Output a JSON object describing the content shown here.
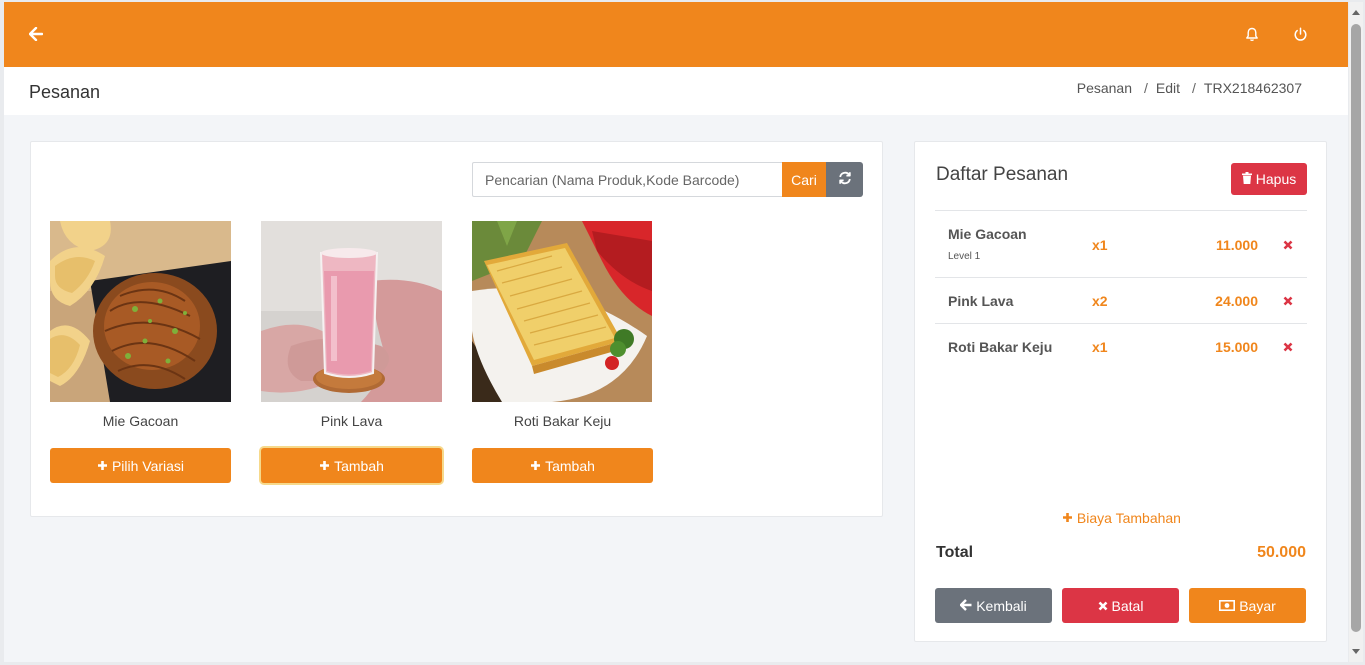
{
  "topbar": {
    "back_icon": "arrow-left-icon",
    "bell_icon": "bell-icon",
    "power_icon": "power-icon",
    "color": "#f0861c"
  },
  "header": {
    "title": "Pesanan",
    "breadcrumb": [
      "Pesanan",
      "Edit",
      "TRX218462307"
    ]
  },
  "search": {
    "placeholder": "Pencarian (Nama Produk,Kode Barcode)",
    "value": "",
    "button_label": "Cari"
  },
  "products": [
    {
      "name": "Mie Gacoan",
      "button_label": "Pilih Variasi"
    },
    {
      "name": "Pink Lava",
      "button_label": "Tambah"
    },
    {
      "name": "Roti Bakar Keju",
      "button_label": "Tambah"
    }
  ],
  "order": {
    "title": "Daftar Pesanan",
    "clear_label": "Hapus",
    "items": [
      {
        "name": "Mie Gacoan",
        "variant": "Level 1",
        "qty": "x1",
        "price": "11.000"
      },
      {
        "name": "Pink Lava",
        "variant": "",
        "qty": "x2",
        "price": "24.000"
      },
      {
        "name": "Roti Bakar Keju",
        "variant": "",
        "qty": "x1",
        "price": "15.000"
      }
    ],
    "extra_fee_label": "Biaya Tambahan",
    "total_label": "Total",
    "total_value": "50.000",
    "buttons": {
      "back": "Kembali",
      "cancel": "Batal",
      "pay": "Bayar"
    }
  },
  "colors": {
    "accent": "#f0861c",
    "danger": "#dc3545",
    "secondary": "#6b727b"
  }
}
